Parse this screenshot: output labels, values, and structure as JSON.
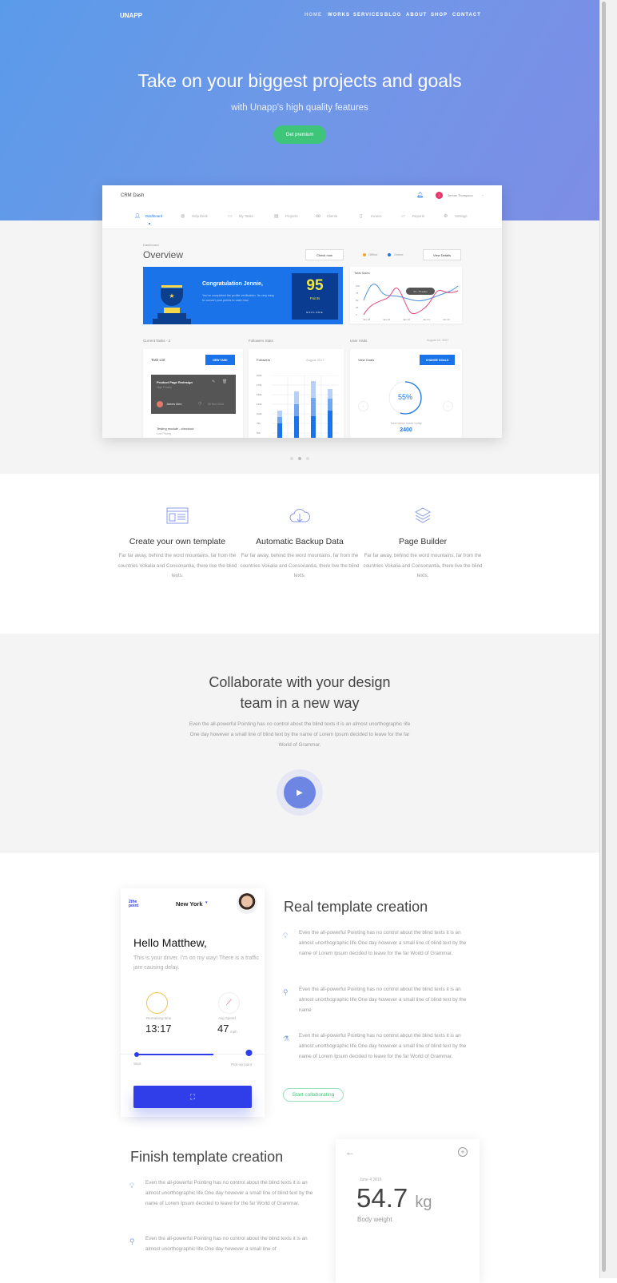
{
  "brand": "UNAPP",
  "nav": [
    "HOME",
    "WORKS",
    "SERVICES",
    "BLOG",
    "ABOUT",
    "SHOP",
    "CONTACT"
  ],
  "hero": {
    "title": "Take on your biggest projects and goals",
    "subtitle": "with Unapp's high quality features",
    "cta": "Get premium"
  },
  "dash": {
    "app": "CRM Dash",
    "user": "Jennie Thompson",
    "user_initial": "J",
    "tabs": [
      "Dashboard",
      "Help Desk",
      "My Tasks",
      "Projects",
      "Clients",
      "Invoice",
      "Reports",
      "Settings"
    ],
    "breadcrumb": "Dashboard",
    "title": "Overview",
    "check_now": "Check now",
    "offline": "Offline",
    "online": "Online",
    "view_details": "View Details",
    "congrats_title": "Congratulation Jennie,",
    "congrats_text": "You've completed the profile verification. Its very easy to convert your points to cash now.",
    "points": "95",
    "points_label": "Points",
    "explore": "EXPLORE",
    "sales_title": "Total Sales",
    "sales_tooltip": "50 - 75 sales",
    "sales_y": [
      "100",
      "75",
      "50",
      "25",
      "0"
    ],
    "sales_x": [
      "Jan 18",
      "Jan 19",
      "Jan 20",
      "Jan 21",
      "Jan 22"
    ],
    "tasks_label": "Current Tasks - 2",
    "task_list": "Task List",
    "new_task": "NEW TASK",
    "task1": {
      "title": "Product Page Redesign",
      "priority": "High Priority",
      "assignee": "James Alex",
      "date": "30 Nov 2016"
    },
    "task2": {
      "title": "Testing module - checkout",
      "priority": "Low Priority"
    },
    "followers_label": "Followers Stats",
    "followers": "Followers",
    "followers_month": "August 2017",
    "followers_y": [
      "200k",
      "175k",
      "150k",
      "125k",
      "100k",
      "75k",
      "50k"
    ],
    "visits_label": "User Visits",
    "visits_date": "August 12, 2017",
    "view_goals": "View Goals",
    "change_goals": "CHANGE GOALS",
    "goal_percent": "55%",
    "goal_fraction": 0.55,
    "views_label": "Total views made today",
    "views": "2400"
  },
  "slider": {
    "active": 1,
    "count": 3
  },
  "features": [
    {
      "icon": "template-icon",
      "title": "Create your own template",
      "text": "Far far away, behind the word mountains, far from the countries Vokalia and Consonantia, there live the blind texts."
    },
    {
      "icon": "cloud-download-icon",
      "title": "Automatic Backup Data",
      "text": "Far far away, behind the word mountains, far from the countries Vokalia and Consonantia, there live the blind texts."
    },
    {
      "icon": "layers-icon",
      "title": "Page Builder",
      "text": "Far far away, behind the word mountains, far from the countries Vokalia and Consonantia, there live the blind texts."
    }
  ],
  "collab": {
    "title_line1": "Collaborate with your design",
    "title_line2": "team in a new way",
    "text": "Even the all-powerful Pointing has no control about the blind texts it is an almost unorthographic life One day however a small line of blind text by the name of Lorem Ipsum decided to leave for the far World of Grammar."
  },
  "phone": {
    "logo": "2the point",
    "city": "New York",
    "greeting": "Hello Matthew,",
    "message": "This is your driver. I'm on my way! There is a traffic jam causing delay.",
    "remaining_label": "Remaining time",
    "remaining": "13:17",
    "speed_label": "Avg Speed",
    "speed": "47",
    "speed_unit": "mph",
    "start": "Start",
    "pickup": "Pick-up point"
  },
  "real": {
    "title": "Real template creation",
    "items": [
      "Even the all-powerful Pointing has no control about the blind texts it is an almost unorthographic life One day however a small line of blind text by the name of Lorem Ipsum decided to leave for the far World of Grammar.",
      "Even the all-powerful Pointing has no control about the blind texts it is an almost unorthographic life One day however a small line of blind text by the name",
      "Even the all-powerful Pointing has no control about the blind texts it is an almost unorthographic life One day however a small line of blind text by the name of Lorem Ipsum decided to leave for the far World of Grammar."
    ],
    "cta": "Start collaborating"
  },
  "finish": {
    "title": "Finish template creation",
    "items": [
      "Even the all-powerful Pointing has no control about the blind texts it is an almost unorthographic life One day however a small line of blind text by the name of Lorem Ipsum decided to leave for the far World of Grammar.",
      "Even the all-powerful Pointing has no control about the blind texts it is an almost unorthographic life One day however a small line of"
    ]
  },
  "weight": {
    "date": "June 4 2015",
    "value": "54.7",
    "unit": "kg",
    "label": "Body weight"
  },
  "colors": {
    "accent": "#1a73e8",
    "green": "#3fc57a",
    "indigo": "#2f3ee8",
    "play": "#6d85e3"
  }
}
